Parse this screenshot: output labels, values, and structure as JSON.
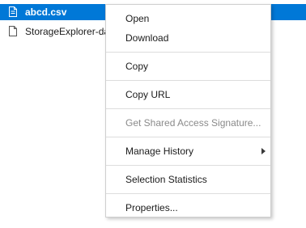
{
  "files": [
    {
      "name": "abcd.csv",
      "icon": "file-icon",
      "selected": true
    },
    {
      "name": "StorageExplorer-da",
      "icon": "file-icon",
      "selected": false
    }
  ],
  "context_menu": {
    "open": "Open",
    "download": "Download",
    "copy": "Copy",
    "copy_url": "Copy URL",
    "get_sas": "Get Shared Access Signature...",
    "manage_history": "Manage History",
    "selection_statistics": "Selection Statistics",
    "properties": "Properties..."
  },
  "colors": {
    "selection": "#0078d7",
    "disabled_text": "#8a8a8a"
  }
}
